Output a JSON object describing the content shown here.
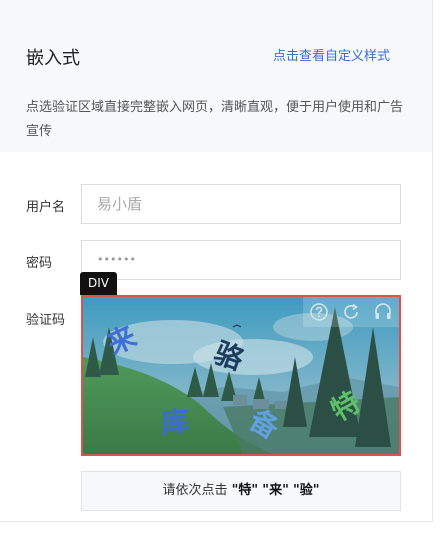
{
  "header": {
    "title": "嵌入式",
    "link": "点击查看自定义样式",
    "description": "点选验证区域直接完整嵌入网页，清晰直观，便于用户使用和广告宣传"
  },
  "form": {
    "username_label": "用户名",
    "username_placeholder": "易小盾",
    "password_label": "密码",
    "password_value": "••••••",
    "captcha_label": "验证码"
  },
  "debug_tag": "DIV",
  "captcha": {
    "chars": [
      "来",
      "骆",
      "库",
      "备",
      "特"
    ],
    "icons": [
      "help-icon",
      "refresh-icon",
      "audio-icon"
    ]
  },
  "instruction": {
    "prefix": "请依次点击",
    "targets": [
      "\"特\"",
      "\"来\"",
      "\"验\""
    ]
  },
  "colors": {
    "link": "#3a6cd8",
    "highlight_border": "#d9534f",
    "header_bg": "#f7f8fa"
  }
}
